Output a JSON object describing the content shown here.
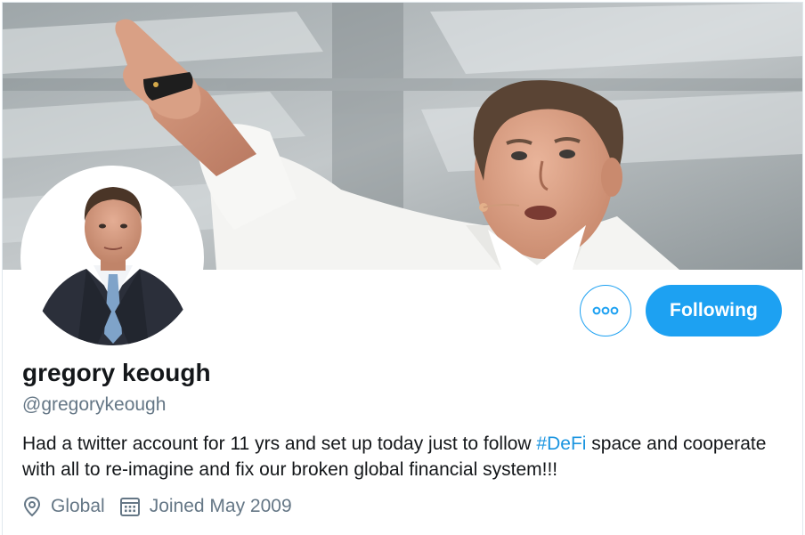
{
  "profile": {
    "name": "gregory keough",
    "handle": "@gregorykeough",
    "bio": {
      "before": "Had a twitter account for 11 yrs and set up today just to follow ",
      "hashtag": "#DeFi",
      "after": " space and cooperate with all to re-imagine and fix our broken global financial system!!!"
    },
    "location": "Global",
    "joined": "Joined May 2009"
  },
  "actions": {
    "more_icon": "more-horizontal-icon",
    "following_label": "Following"
  },
  "icons": {
    "location": "location-pin-icon",
    "joined": "calendar-icon"
  },
  "colors": {
    "accent": "#1da1f2",
    "hashtag": "#1b95e0",
    "secondary_text": "#657786",
    "primary_text": "#14171a"
  }
}
